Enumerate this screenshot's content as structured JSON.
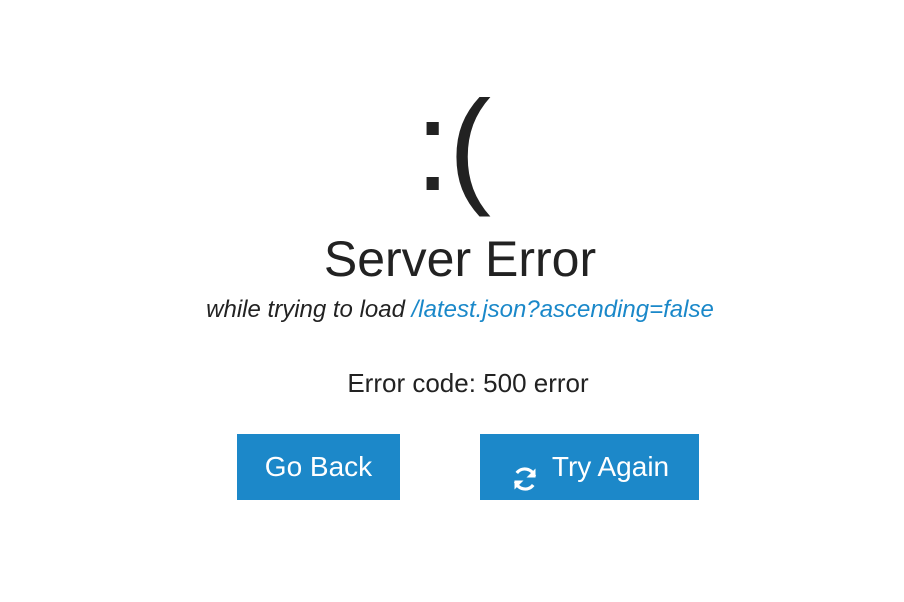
{
  "error": {
    "face": ":(",
    "title": "Server Error",
    "subtitle_prefix": "while trying to load ",
    "path": "/latest.json?ascending=false",
    "code_text": "Error code: 500 error"
  },
  "actions": {
    "back_label": "Go Back",
    "retry_label": "Try Again",
    "retry_icon": "refresh-icon"
  },
  "colors": {
    "accent": "#1c88c9",
    "link": "#1a88c9",
    "text": "#222222"
  }
}
